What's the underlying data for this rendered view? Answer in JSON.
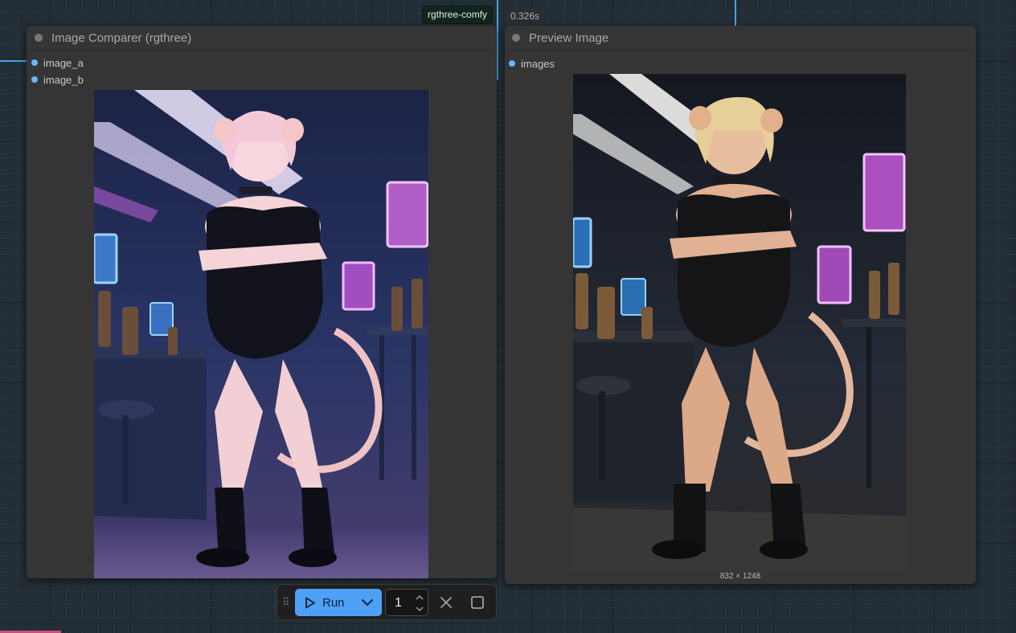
{
  "colors": {
    "canvas_bg": "#222d35",
    "node_bg": "#353535",
    "link_blue": "#4aa3ea",
    "slot_blue": "#6cb4ff",
    "run_accent": "#4da0f6",
    "badge_green_bg": "#10261c"
  },
  "badges": {
    "source": "rgthree-comfy",
    "exec_time": "0.326s"
  },
  "image_comparer": {
    "title": "Image Comparer (rgthree)",
    "inputs": [
      {
        "name": "image_a"
      },
      {
        "name": "image_b"
      }
    ],
    "image_description": "stylized anime character image (generated output A)"
  },
  "preview_image": {
    "title": "Preview Image",
    "inputs": [
      {
        "name": "images"
      }
    ],
    "image_description": "realistic render of the same character (generated output B)",
    "dimensions_label": "832 × 1248"
  },
  "toolbar": {
    "run_label": "Run",
    "batch_count": "1",
    "icons": [
      "drag-handle-icon",
      "play-icon",
      "chevron-down-icon",
      "increment-icon",
      "decrement-icon",
      "close-icon",
      "stop-icon"
    ]
  }
}
